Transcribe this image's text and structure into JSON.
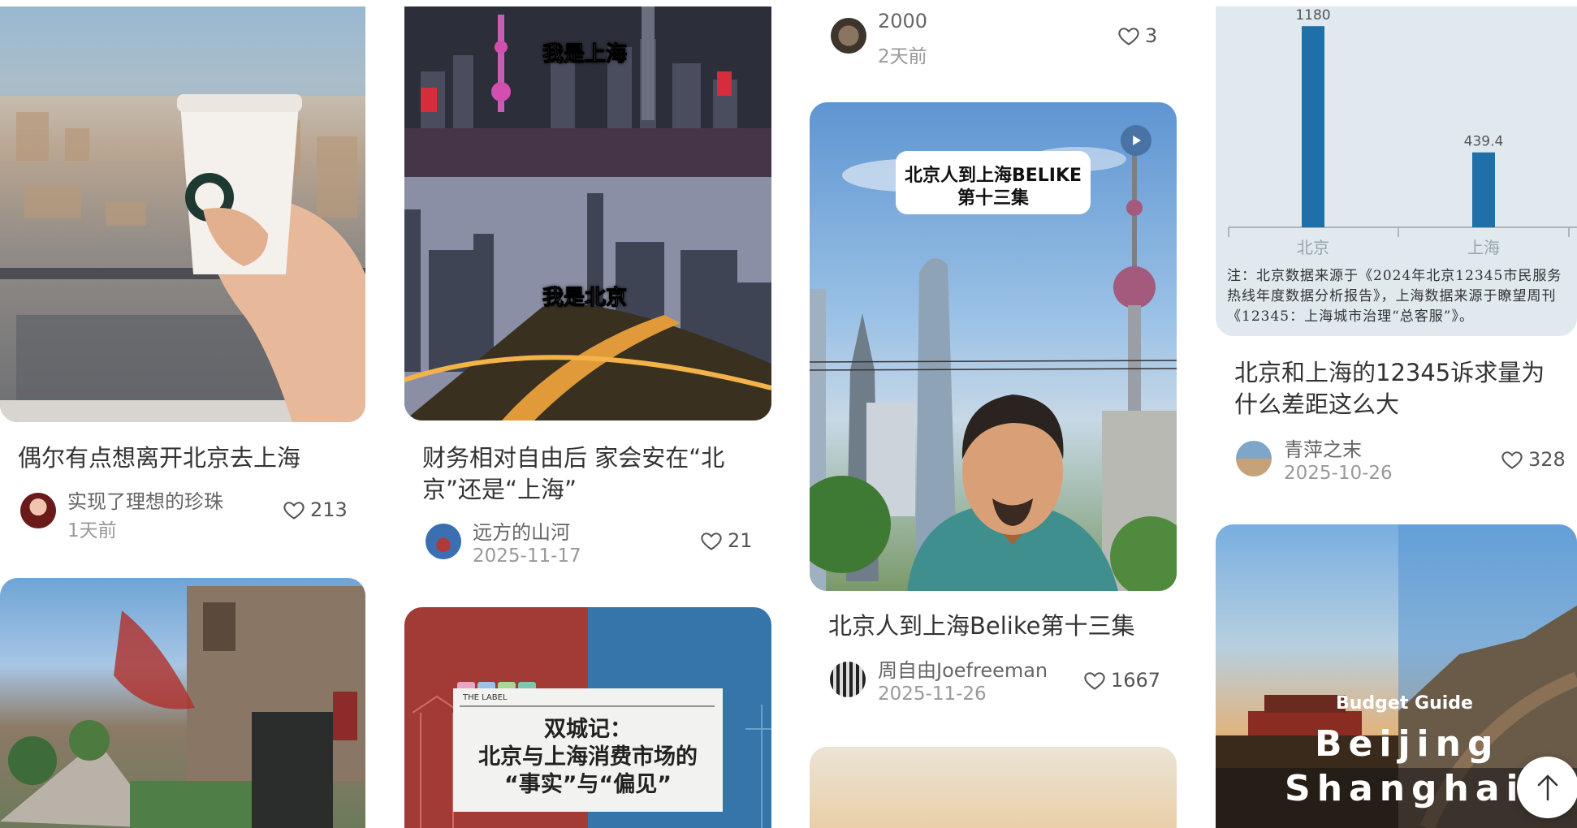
{
  "cards": [
    {
      "title": "偶尔有点想离开北京去上海",
      "author": "实现了理想的珍珠",
      "date": "1天前",
      "likes": "213",
      "image_icon": "starbucks-cup-photo"
    },
    {
      "title": "财务相对自由后 家会安在“北京”还是“上海”",
      "author": "远方的山河",
      "date": "2025-11-17",
      "likes": "21",
      "image_text_top": "我是上海",
      "image_text_bottom": "我是北京"
    },
    {
      "author": "2000",
      "date": "2天前",
      "likes": "3"
    },
    {
      "title": "北京人到上海Belike第十三集",
      "author": "周自由Joefreeman",
      "date": "2025-11-26",
      "likes": "1667",
      "image_text_line1": "北京人到上海BELIKE",
      "image_text_line2": "第十三集",
      "play_icon": "play-icon"
    },
    {
      "title": "北京和上海的12345诉求量为什么差距这么大",
      "author": "青萍之末",
      "date": "2025-10-26",
      "likes": "328",
      "note": "注：北京数据来源于《2024年北京12345市民服务热线年度数据分析报告》，上海数据来源于瞭望周刊《12345：上海城市治理“总客服”》。"
    },
    {
      "image_tag": "THE LABEL",
      "image_title_line1": "双城记：",
      "image_title_line2": "北京与上海消费市场的",
      "image_title_line3": "“事实”与“偏见”"
    },
    {
      "image_subtitle": "Budget Guide",
      "image_line1": "Beijing",
      "image_line2": "Shanghai"
    }
  ],
  "chart_data": {
    "type": "bar",
    "categories": [
      "北京",
      "上海"
    ],
    "values": [
      1180,
      439.4
    ],
    "ylim": [
      0,
      1200
    ]
  },
  "colors": {
    "bar": "#1f6fa8",
    "chart_bg": "#dfe9ee"
  },
  "back_to_top_icon": "arrow-up-icon"
}
